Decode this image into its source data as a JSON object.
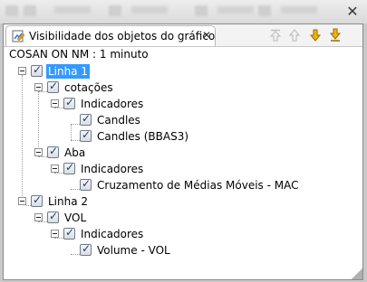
{
  "window": {
    "close_glyph": "✕"
  },
  "tab": {
    "title": "Visibilidade dos objetos do gráfico",
    "close_glyph": "✕",
    "icon": "visibility-view-icon"
  },
  "toolbar": {
    "buttons": [
      {
        "icon": "move-top-icon",
        "enabled": false
      },
      {
        "icon": "move-up-icon",
        "enabled": false
      },
      {
        "icon": "move-down-icon",
        "enabled": true
      },
      {
        "icon": "move-bottom-icon",
        "enabled": true
      }
    ]
  },
  "header": {
    "label": "COSAN ON NM : 1 minuto"
  },
  "tree": {
    "linha1": {
      "label": "Linha 1",
      "checked": true,
      "selected": true,
      "cotacoes": {
        "label": "cotações",
        "indicadores": {
          "label": "Indicadores",
          "items": [
            "Candles",
            "Candles (BBAS3)"
          ]
        }
      },
      "aba": {
        "label": "Aba",
        "indicadores": {
          "label": "Indicadores",
          "items": [
            "Cruzamento de Médias Móveis - MAC"
          ]
        }
      }
    },
    "linha2": {
      "label": "Linha 2",
      "checked": true,
      "vol": {
        "label": "VOL",
        "indicadores": {
          "label": "Indicadores",
          "items": [
            "Volume - VOL"
          ]
        }
      }
    }
  },
  "colors": {
    "selection": "#3399ff",
    "check": "#1c3b8a",
    "arrow_enabled": "#e8a400",
    "arrow_disabled": "#c0c0c0"
  }
}
